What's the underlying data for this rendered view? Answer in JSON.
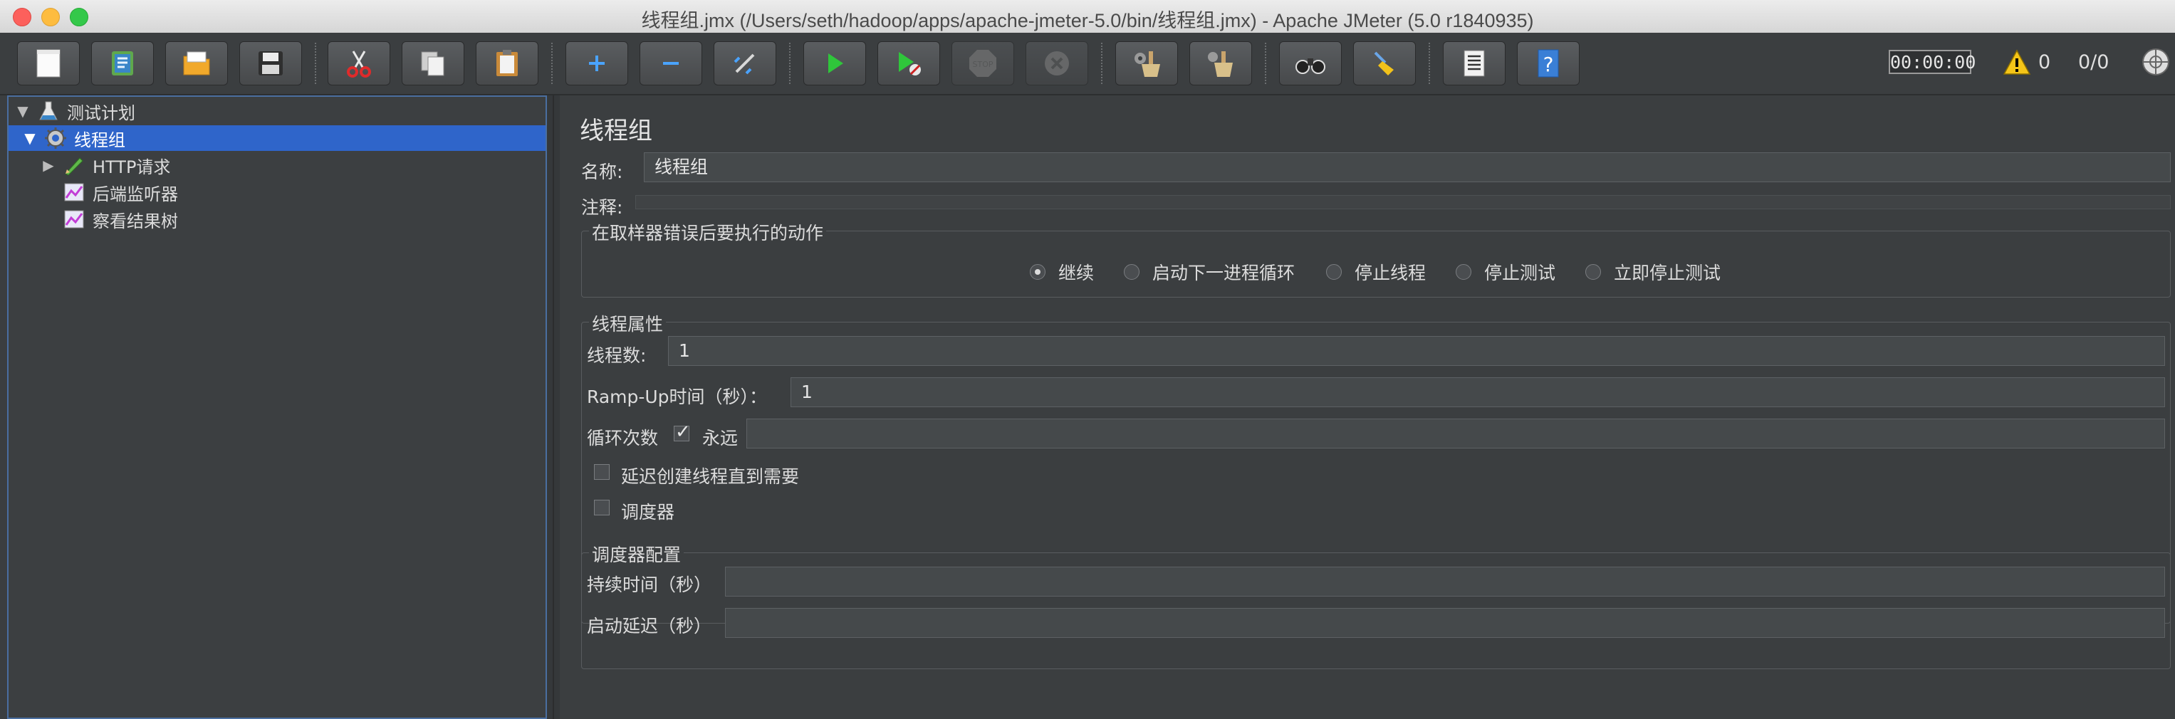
{
  "window": {
    "title": "线程组.jmx (/Users/seth/hadoop/apps/apache-jmeter-5.0/bin/线程组.jmx) - Apache JMeter (5.0 r1840935)"
  },
  "toolbar": {
    "timer": "00:00:00",
    "warning_count": "0",
    "thread_count": "0/0"
  },
  "tree": {
    "items": [
      {
        "label": "测试计划",
        "icon": "test-plan-flask-icon"
      },
      {
        "label": "线程组",
        "icon": "thread-group-gear-icon",
        "selected": true
      },
      {
        "label": "HTTP请求",
        "icon": "http-sampler-pen-icon"
      },
      {
        "label": "后端监听器",
        "icon": "listener-chart-icon"
      },
      {
        "label": "察看结果树",
        "icon": "listener-chart-icon"
      }
    ]
  },
  "main": {
    "title": "线程组",
    "name_label": "名称:",
    "name_value": "线程组",
    "comment_label": "注释:",
    "on_error": {
      "title": "在取样器错误后要执行的动作",
      "options": [
        "继续",
        "启动下一进程循环",
        "停止线程",
        "停止测试",
        "立即停止测试"
      ],
      "selected": "继续"
    },
    "thread_props": {
      "title": "线程属性",
      "threads_label": "线程数:",
      "threads_value": "1",
      "rampup_label": "Ramp-Up时间（秒）：",
      "rampup_value": "1",
      "loop_label": "循环次数",
      "forever_label": "永远",
      "delay_label": "延迟创建线程直到需要",
      "scheduler_label": "调度器"
    },
    "scheduler": {
      "title": "调度器配置",
      "duration_label": "持续时间（秒）",
      "delay_label": "启动延迟（秒）"
    }
  },
  "colors": {
    "background": "#3b3e40",
    "selection": "#2f65ca",
    "toolbar_button": "#4f5254"
  }
}
